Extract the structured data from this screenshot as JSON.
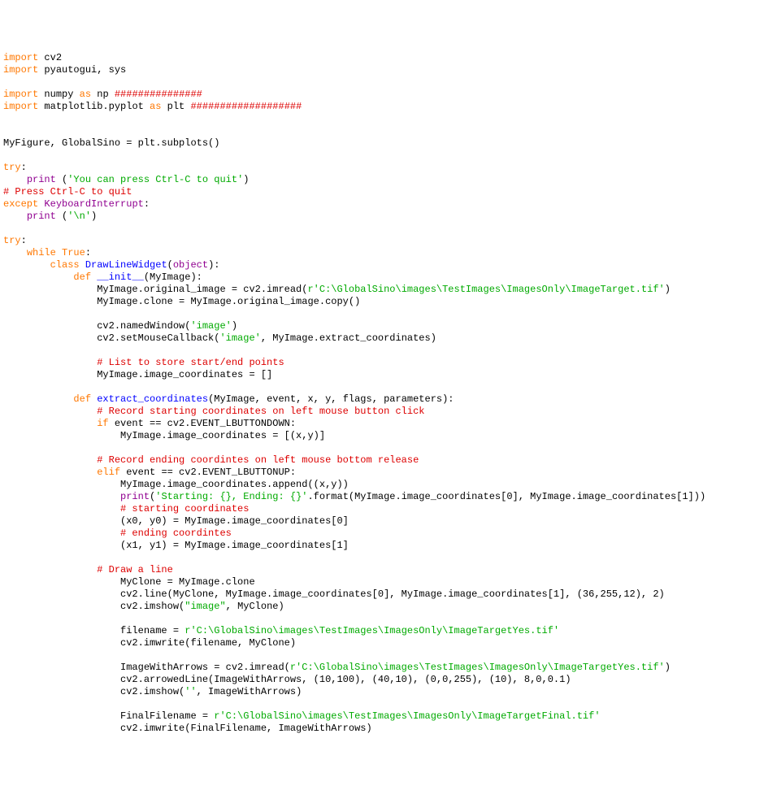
{
  "lines": [
    {
      "segs": [
        {
          "c": "kw-orange",
          "t": "import"
        },
        {
          "c": "",
          "t": " cv2"
        }
      ]
    },
    {
      "segs": [
        {
          "c": "kw-orange",
          "t": "import"
        },
        {
          "c": "",
          "t": " pyautogui, sys"
        }
      ]
    },
    {
      "segs": [
        {
          "c": "",
          "t": ""
        }
      ]
    },
    {
      "segs": [
        {
          "c": "kw-orange",
          "t": "import"
        },
        {
          "c": "",
          "t": " numpy "
        },
        {
          "c": "kw-orange",
          "t": "as"
        },
        {
          "c": "",
          "t": " np "
        },
        {
          "c": "cmt-red",
          "t": "###############"
        }
      ]
    },
    {
      "segs": [
        {
          "c": "kw-orange",
          "t": "import"
        },
        {
          "c": "",
          "t": " matplotlib.pyplot "
        },
        {
          "c": "kw-orange",
          "t": "as"
        },
        {
          "c": "",
          "t": " plt "
        },
        {
          "c": "cmt-red",
          "t": "###################"
        }
      ]
    },
    {
      "segs": [
        {
          "c": "",
          "t": ""
        }
      ]
    },
    {
      "segs": [
        {
          "c": "",
          "t": ""
        }
      ]
    },
    {
      "segs": [
        {
          "c": "",
          "t": "MyFigure, GlobalSino = plt.subplots()"
        }
      ]
    },
    {
      "segs": [
        {
          "c": "",
          "t": ""
        }
      ]
    },
    {
      "segs": [
        {
          "c": "kw-orange",
          "t": "try"
        },
        {
          "c": "",
          "t": ":"
        }
      ]
    },
    {
      "segs": [
        {
          "c": "",
          "t": "    "
        },
        {
          "c": "kw-purple",
          "t": "print"
        },
        {
          "c": "",
          "t": " ("
        },
        {
          "c": "str-green",
          "t": "'You can press Ctrl-C to quit'"
        },
        {
          "c": "",
          "t": ")"
        }
      ]
    },
    {
      "segs": [
        {
          "c": "cmt-red",
          "t": "# Press Ctrl-C to quit"
        }
      ]
    },
    {
      "segs": [
        {
          "c": "kw-orange",
          "t": "except"
        },
        {
          "c": "",
          "t": " "
        },
        {
          "c": "kw-purple",
          "t": "KeyboardInterrupt"
        },
        {
          "c": "",
          "t": ":"
        }
      ]
    },
    {
      "segs": [
        {
          "c": "",
          "t": "    "
        },
        {
          "c": "kw-purple",
          "t": "print"
        },
        {
          "c": "",
          "t": " ("
        },
        {
          "c": "str-green",
          "t": "'\\n'"
        },
        {
          "c": "",
          "t": ")"
        }
      ]
    },
    {
      "segs": [
        {
          "c": "",
          "t": ""
        }
      ]
    },
    {
      "segs": [
        {
          "c": "kw-orange",
          "t": "try"
        },
        {
          "c": "",
          "t": ":"
        }
      ]
    },
    {
      "segs": [
        {
          "c": "",
          "t": "    "
        },
        {
          "c": "kw-orange",
          "t": "while"
        },
        {
          "c": "",
          "t": " "
        },
        {
          "c": "kw-orange",
          "t": "True"
        },
        {
          "c": "",
          "t": ":"
        }
      ]
    },
    {
      "segs": [
        {
          "c": "",
          "t": "        "
        },
        {
          "c": "kw-orange",
          "t": "class"
        },
        {
          "c": "",
          "t": " "
        },
        {
          "c": "kw-blue",
          "t": "DrawLineWidget"
        },
        {
          "c": "",
          "t": "("
        },
        {
          "c": "kw-purple",
          "t": "object"
        },
        {
          "c": "",
          "t": "):"
        }
      ]
    },
    {
      "segs": [
        {
          "c": "",
          "t": "            "
        },
        {
          "c": "kw-orange",
          "t": "def"
        },
        {
          "c": "",
          "t": " "
        },
        {
          "c": "kw-blue",
          "t": "__init__"
        },
        {
          "c": "",
          "t": "(MyImage):"
        }
      ]
    },
    {
      "segs": [
        {
          "c": "",
          "t": "                MyImage.original_image = cv2.imread("
        },
        {
          "c": "str-green",
          "t": "r'C:\\GlobalSino\\images\\TestImages\\ImagesOnly\\ImageTarget.tif'"
        },
        {
          "c": "",
          "t": ")"
        }
      ]
    },
    {
      "segs": [
        {
          "c": "",
          "t": "                MyImage.clone = MyImage.original_image.copy()"
        }
      ]
    },
    {
      "segs": [
        {
          "c": "",
          "t": ""
        }
      ]
    },
    {
      "segs": [
        {
          "c": "",
          "t": "                cv2.namedWindow("
        },
        {
          "c": "str-green",
          "t": "'image'"
        },
        {
          "c": "",
          "t": ")"
        }
      ]
    },
    {
      "segs": [
        {
          "c": "",
          "t": "                cv2.setMouseCallback("
        },
        {
          "c": "str-green",
          "t": "'image'"
        },
        {
          "c": "",
          "t": ", MyImage.extract_coordinates)"
        }
      ]
    },
    {
      "segs": [
        {
          "c": "",
          "t": ""
        }
      ]
    },
    {
      "segs": [
        {
          "c": "",
          "t": "                "
        },
        {
          "c": "cmt-red",
          "t": "# List to store start/end points"
        }
      ]
    },
    {
      "segs": [
        {
          "c": "",
          "t": "                MyImage.image_coordinates = []"
        }
      ]
    },
    {
      "segs": [
        {
          "c": "",
          "t": ""
        }
      ]
    },
    {
      "segs": [
        {
          "c": "",
          "t": "            "
        },
        {
          "c": "kw-orange",
          "t": "def"
        },
        {
          "c": "",
          "t": " "
        },
        {
          "c": "kw-blue",
          "t": "extract_coordinates"
        },
        {
          "c": "",
          "t": "(MyImage, event, x, y, flags, parameters):"
        }
      ]
    },
    {
      "segs": [
        {
          "c": "",
          "t": "                "
        },
        {
          "c": "cmt-red",
          "t": "# Record starting coordinates on left mouse button click"
        }
      ]
    },
    {
      "segs": [
        {
          "c": "",
          "t": "                "
        },
        {
          "c": "kw-orange",
          "t": "if"
        },
        {
          "c": "",
          "t": " event == cv2.EVENT_LBUTTONDOWN:"
        }
      ]
    },
    {
      "segs": [
        {
          "c": "",
          "t": "                    MyImage.image_coordinates = [(x,y)]"
        }
      ]
    },
    {
      "segs": [
        {
          "c": "",
          "t": ""
        }
      ]
    },
    {
      "segs": [
        {
          "c": "",
          "t": "                "
        },
        {
          "c": "cmt-red",
          "t": "# Record ending coordintes on left mouse bottom release"
        }
      ]
    },
    {
      "segs": [
        {
          "c": "",
          "t": "                "
        },
        {
          "c": "kw-orange",
          "t": "elif"
        },
        {
          "c": "",
          "t": " event == cv2.EVENT_LBUTTONUP:"
        }
      ]
    },
    {
      "segs": [
        {
          "c": "",
          "t": "                    MyImage.image_coordinates.append((x,y))"
        }
      ]
    },
    {
      "segs": [
        {
          "c": "",
          "t": "                    "
        },
        {
          "c": "kw-purple",
          "t": "print"
        },
        {
          "c": "",
          "t": "("
        },
        {
          "c": "str-green",
          "t": "'Starting: {}, Ending: {}'"
        },
        {
          "c": "",
          "t": ".format(MyImage.image_coordinates[0], MyImage.image_coordinates[1]))"
        }
      ]
    },
    {
      "segs": [
        {
          "c": "",
          "t": "                    "
        },
        {
          "c": "cmt-red",
          "t": "# starting coordinates"
        }
      ]
    },
    {
      "segs": [
        {
          "c": "",
          "t": "                    (x0, y0) = MyImage.image_coordinates[0]"
        }
      ]
    },
    {
      "segs": [
        {
          "c": "",
          "t": "                    "
        },
        {
          "c": "cmt-red",
          "t": "# ending coordintes"
        }
      ]
    },
    {
      "segs": [
        {
          "c": "",
          "t": "                    (x1, y1) = MyImage.image_coordinates[1]"
        }
      ]
    },
    {
      "segs": [
        {
          "c": "",
          "t": ""
        }
      ]
    },
    {
      "segs": [
        {
          "c": "",
          "t": "                "
        },
        {
          "c": "cmt-red",
          "t": "# Draw a line"
        }
      ]
    },
    {
      "segs": [
        {
          "c": "",
          "t": "                    MyClone = MyImage.clone"
        }
      ]
    },
    {
      "segs": [
        {
          "c": "",
          "t": "                    cv2.line(MyClone, MyImage.image_coordinates[0], MyImage.image_coordinates[1], (36,255,12), 2)"
        }
      ]
    },
    {
      "segs": [
        {
          "c": "",
          "t": "                    cv2.imshow("
        },
        {
          "c": "str-green",
          "t": "\"image\""
        },
        {
          "c": "",
          "t": ", MyClone)"
        }
      ]
    },
    {
      "segs": [
        {
          "c": "",
          "t": ""
        }
      ]
    },
    {
      "segs": [
        {
          "c": "",
          "t": "                    filename = "
        },
        {
          "c": "str-green",
          "t": "r'C:\\GlobalSino\\images\\TestImages\\ImagesOnly\\ImageTargetYes.tif'"
        }
      ]
    },
    {
      "segs": [
        {
          "c": "",
          "t": "                    cv2.imwrite(filename, MyClone)"
        }
      ]
    },
    {
      "segs": [
        {
          "c": "",
          "t": ""
        }
      ]
    },
    {
      "segs": [
        {
          "c": "",
          "t": "                    ImageWithArrows = cv2.imread("
        },
        {
          "c": "str-green",
          "t": "r'C:\\GlobalSino\\images\\TestImages\\ImagesOnly\\ImageTargetYes.tif'"
        },
        {
          "c": "",
          "t": ")"
        }
      ]
    },
    {
      "segs": [
        {
          "c": "",
          "t": "                    cv2.arrowedLine(ImageWithArrows, (10,100), (40,10), (0,0,255), (10), 8,0,0.1)"
        }
      ]
    },
    {
      "segs": [
        {
          "c": "",
          "t": "                    cv2.imshow("
        },
        {
          "c": "str-green",
          "t": "''"
        },
        {
          "c": "",
          "t": ", ImageWithArrows)"
        }
      ]
    },
    {
      "segs": [
        {
          "c": "",
          "t": ""
        }
      ]
    },
    {
      "segs": [
        {
          "c": "",
          "t": "                    FinalFilename = "
        },
        {
          "c": "str-green",
          "t": "r'C:\\GlobalSino\\images\\TestImages\\ImagesOnly\\ImageTargetFinal.tif'"
        }
      ]
    },
    {
      "segs": [
        {
          "c": "",
          "t": "                    cv2.imwrite(FinalFilename, ImageWithArrows)"
        }
      ]
    }
  ]
}
